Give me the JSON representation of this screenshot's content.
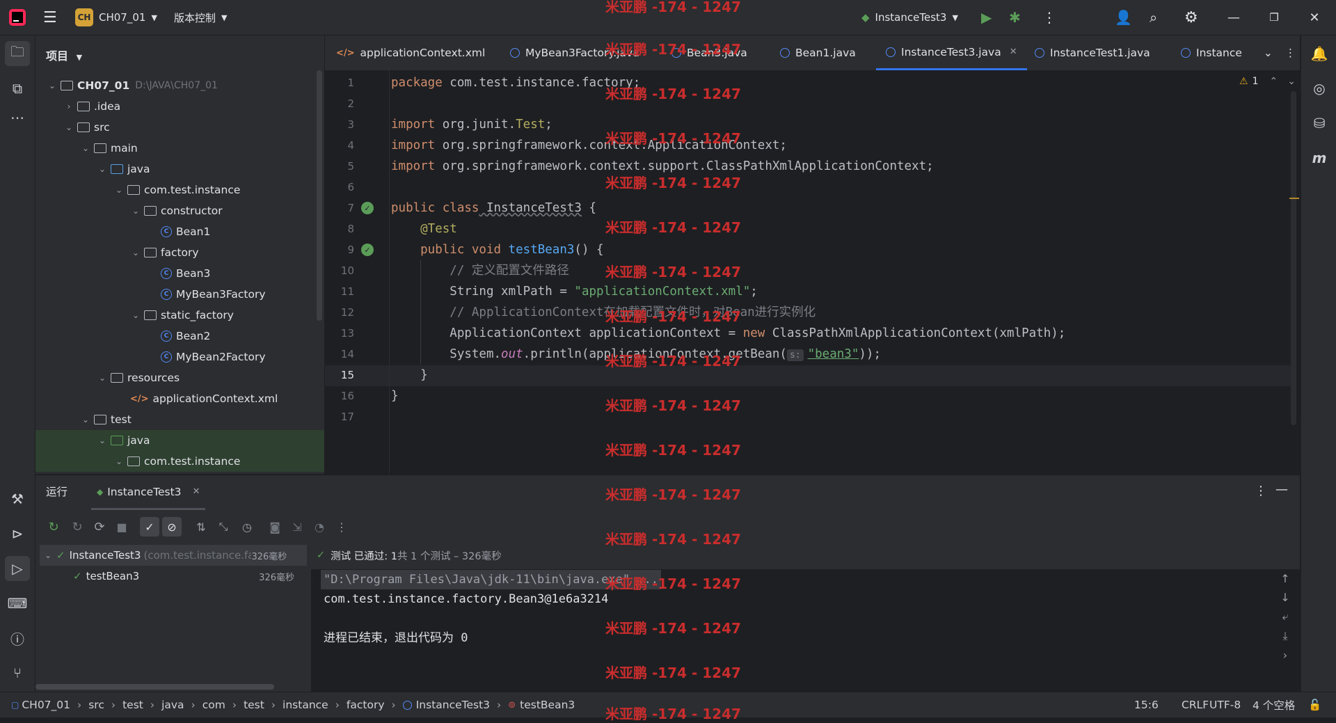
{
  "titlebar": {
    "project_badge": "CH",
    "project_name": "CH07_01",
    "vcs": "版本控制",
    "run_config": "InstanceTest3"
  },
  "project_panel": {
    "title": "项目",
    "root_name": "CH07_01",
    "root_path": "D:\\JAVA\\CH07_01",
    "items": [
      {
        "label": ".idea"
      },
      {
        "label": "src"
      },
      {
        "label": "main"
      },
      {
        "label": "java"
      },
      {
        "label": "com.test.instance"
      },
      {
        "label": "constructor"
      },
      {
        "label": "Bean1"
      },
      {
        "label": "factory"
      },
      {
        "label": "Bean3"
      },
      {
        "label": "MyBean3Factory"
      },
      {
        "label": "static_factory"
      },
      {
        "label": "Bean2"
      },
      {
        "label": "MyBean2Factory"
      },
      {
        "label": "resources"
      },
      {
        "label": "applicationContext.xml"
      },
      {
        "label": "test"
      },
      {
        "label": "java"
      },
      {
        "label": "com.test.instance"
      }
    ]
  },
  "tabs": [
    {
      "label": "applicationContext.xml"
    },
    {
      "label": "MyBean3Factory.java"
    },
    {
      "label": "Bean3.java"
    },
    {
      "label": "Bean1.java"
    },
    {
      "label": "InstanceTest3.java"
    },
    {
      "label": "InstanceTest1.java"
    },
    {
      "label": "Instance"
    }
  ],
  "editor": {
    "warning_count": "1",
    "line_numbers": [
      "1",
      "2",
      "3",
      "4",
      "5",
      "6",
      "7",
      "8",
      "9",
      "10",
      "11",
      "12",
      "13",
      "14",
      "15",
      "16",
      "17"
    ],
    "lines": {
      "l1a": "package",
      "l1b": " com.test.instance.factory;",
      "l3a": "import",
      "l3b": " org.junit.",
      "l3c": "Test",
      "l3d": ";",
      "l4a": "import",
      "l4b": " org.springframework.context.ApplicationContext;",
      "l5a": "import",
      "l5b": " org.springframework.context.support.ClassPathXmlApplicationContext;",
      "l7a": "public class",
      "l7b": " InstanceTest3",
      "l7c": " {",
      "l8": "    @Test",
      "l9a": "    public void",
      "l9b": " testBean3",
      "l9c": "() {",
      "l10": "        // 定义配置文件路径",
      "l11a": "        String xmlPath = ",
      "l11b": "\"applicationContext.xml\"",
      "l11c": ";",
      "l12": "        // ApplicationContext在加载配置文件时，对Bean进行实例化",
      "l13a": "        ApplicationContext applicationContext = ",
      "l13b": "new",
      "l13c": " ClassPathXmlApplicationContext(xmlPath);",
      "l14a": "        System.",
      "l14b": "out",
      "l14c": ".println(applicationContext.getBean(",
      "l14hint": "s:",
      "l14d": "\"bean3\"",
      "l14e": "));",
      "l15": "    }",
      "l16": "}"
    }
  },
  "run_panel": {
    "tab_run": "运行",
    "tab_config": "InstanceTest3",
    "tree_root": "InstanceTest3",
    "tree_root_pkg": "(com.test.instance.fac",
    "tree_root_time": "326毫秒",
    "tree_child": "testBean3",
    "tree_child_time": "326毫秒",
    "status_prefix": "测试 已通过: 1",
    "status_suffix": "共 1 个测试 – 326毫秒",
    "console": [
      "\"D:\\Program Files\\Java\\jdk-11\\bin\\java.exe\" ...",
      "com.test.instance.factory.Bean3@1e6a3214",
      "",
      "进程已结束，退出代码为 0"
    ]
  },
  "statusbar": {
    "crumbs": [
      "CH07_01",
      "src",
      "test",
      "java",
      "com",
      "test",
      "instance",
      "factory",
      "InstanceTest3",
      "testBean3"
    ],
    "position": "15:6",
    "line_sep": "CRLF",
    "encoding": "UTF-8",
    "indent": "4 个空格"
  },
  "watermark": "米亚鹏 -174 - 1247",
  "colors": {
    "accent": "#3574f0",
    "pass": "#5b9d58",
    "watermark": "#c92d2d"
  }
}
